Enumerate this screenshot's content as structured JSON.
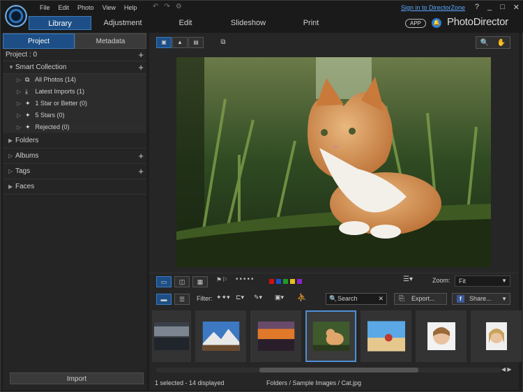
{
  "menu": [
    "File",
    "Edit",
    "Photo",
    "View",
    "Help"
  ],
  "signin": "Sign in to DirectorZone",
  "window_controls": {
    "help": "?",
    "minimize": "_",
    "maximize": "□",
    "close": "✕"
  },
  "modes": [
    {
      "label": "Library",
      "active": true
    },
    {
      "label": "Adjustment"
    },
    {
      "label": "Edit"
    },
    {
      "label": "Slideshow"
    },
    {
      "label": "Print"
    }
  ],
  "app_badge": "APP",
  "brand": "PhotoDirector",
  "panel": {
    "tabs": [
      {
        "label": "Project",
        "active": true
      },
      {
        "label": "Metadata"
      }
    ],
    "project_label": "Project : 0",
    "smart_collection": "Smart Collection",
    "smart_items": [
      "All Photos (14)",
      "Latest Imports (1)",
      "1 Star or Better (0)",
      "5 Stars (0)",
      "Rejected (0)"
    ],
    "folders": "Folders",
    "albums": "Albums",
    "tags": "Tags",
    "faces": "Faces",
    "import": "Import"
  },
  "zoom": {
    "label": "Zoom:",
    "value": "Fit"
  },
  "filter_label": "Filter:",
  "search_placeholder": "Search",
  "export_label": "Export...",
  "share_label": "Share...",
  "color_labels": [
    "#d01010",
    "#1e4fd0",
    "#1f9a2c",
    "#e6c21a",
    "#8e24c8"
  ],
  "status": {
    "count": "1 selected - 14 displayed",
    "path": "Folders / Sample Images / Cat.jpg"
  }
}
